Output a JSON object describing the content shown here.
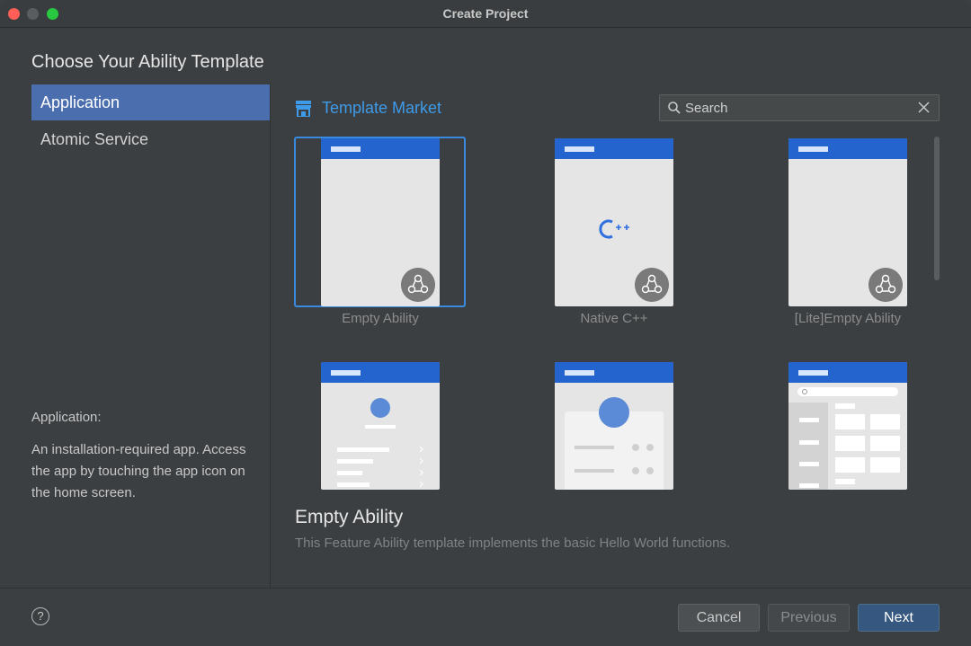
{
  "window": {
    "title": "Create Project"
  },
  "heading": "Choose Your Ability Template",
  "categories": [
    {
      "label": "Application",
      "selected": true
    },
    {
      "label": "Atomic Service",
      "selected": false
    }
  ],
  "description": {
    "title": "Application:",
    "body": "An installation-required app. Access the app by touching the app icon on the home screen."
  },
  "market": {
    "label": "Template Market",
    "icon": "store-icon"
  },
  "search": {
    "placeholder": "Search",
    "value": ""
  },
  "templates": [
    {
      "label": "Empty Ability",
      "selected": true
    },
    {
      "label": "Native C++",
      "selected": false
    },
    {
      "label": "[Lite]Empty Ability",
      "selected": false
    },
    {
      "label": "",
      "selected": false
    },
    {
      "label": "",
      "selected": false
    },
    {
      "label": "",
      "selected": false
    }
  ],
  "detail": {
    "title": "Empty Ability",
    "text": "This Feature Ability template implements the basic Hello World functions."
  },
  "buttons": {
    "cancel": "Cancel",
    "previous": "Previous",
    "next": "Next"
  },
  "colors": {
    "accent": "#3d9be9",
    "selection": "#4b6eaf",
    "card_header": "#2364cf",
    "primary_button": "#365880"
  }
}
